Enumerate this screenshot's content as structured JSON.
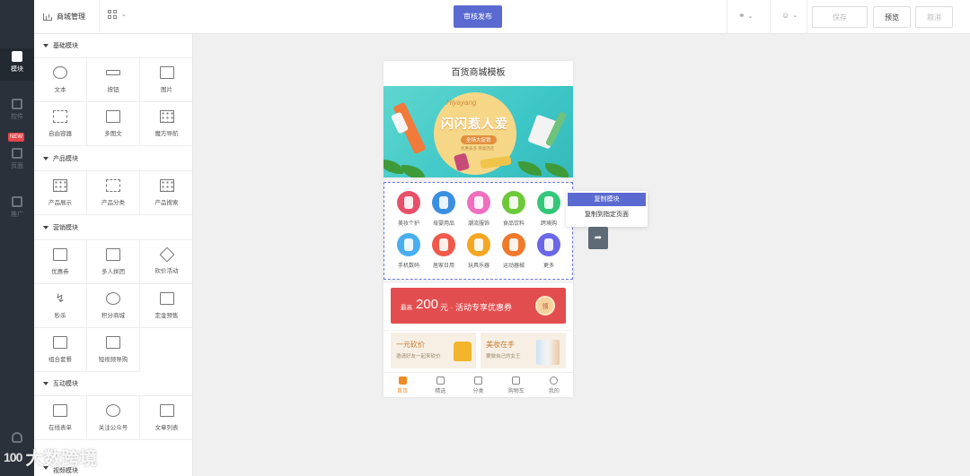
{
  "rail": {
    "items": [
      {
        "label": "模块",
        "icon": "module-icon",
        "active": true
      },
      {
        "label": "控件",
        "icon": "widget-icon",
        "active": false
      },
      {
        "label": "页面",
        "icon": "page-icon",
        "active": false
      },
      {
        "label": "推广",
        "icon": "promote-icon",
        "active": false
      }
    ],
    "new_badge": "NEW"
  },
  "topbar": {
    "store_title": "商城管理",
    "publish_label": "审核发布",
    "save_label": "保存",
    "preview_label": "预览",
    "cancel_label": "取消"
  },
  "sidebar": {
    "categories": [
      {
        "name": "基础模块",
        "items": [
          {
            "label": "文本",
            "icon": "text-icon"
          },
          {
            "label": "按钮",
            "icon": "button-icon"
          },
          {
            "label": "图片",
            "icon": "image-icon"
          },
          {
            "label": "自由容器",
            "icon": "container-icon"
          },
          {
            "label": "多图文",
            "icon": "multi-image-icon"
          },
          {
            "label": "魔方导航",
            "icon": "cube-nav-icon"
          }
        ]
      },
      {
        "name": "产品模块",
        "items": [
          {
            "label": "产品展示",
            "icon": "product-display-icon"
          },
          {
            "label": "产品分类",
            "icon": "product-category-icon"
          },
          {
            "label": "产品搜索",
            "icon": "product-search-icon"
          }
        ]
      },
      {
        "name": "营销模块",
        "items": [
          {
            "label": "优惠券",
            "icon": "coupon-icon"
          },
          {
            "label": "多人拼团",
            "icon": "group-buy-icon"
          },
          {
            "label": "砍价活动",
            "icon": "bargain-icon"
          },
          {
            "label": "秒杀",
            "icon": "flash-sale-icon"
          },
          {
            "label": "积分商城",
            "icon": "points-mall-icon"
          },
          {
            "label": "定金预售",
            "icon": "presale-icon"
          },
          {
            "label": "组合套餐",
            "icon": "bundle-icon"
          },
          {
            "label": "短视频导购",
            "icon": "short-video-icon"
          }
        ]
      },
      {
        "name": "互动模块",
        "items": [
          {
            "label": "在线表单",
            "icon": "form-icon"
          },
          {
            "label": "关注公众号",
            "icon": "follow-icon"
          },
          {
            "label": "文章列表",
            "icon": "article-list-icon"
          }
        ]
      },
      {
        "name": "视频模块",
        "items": []
      }
    ]
  },
  "phone": {
    "title": "百货商城模板",
    "banner": {
      "script": "Hiyayang",
      "title": "闪闪惹人爱",
      "pill": "全场大促销",
      "fine": "优惠多多 惊喜连连"
    },
    "categories": [
      {
        "label": "美妆个护",
        "color": "#e8506a"
      },
      {
        "label": "母婴用品",
        "color": "#3d8fe0"
      },
      {
        "label": "潮流服饰",
        "color": "#f06fbf"
      },
      {
        "label": "食品饮料",
        "color": "#6ec93a"
      },
      {
        "label": "跨境购",
        "color": "#34c779"
      },
      {
        "label": "手机数码",
        "color": "#48aef0"
      },
      {
        "label": "居家日用",
        "color": "#f05a4b"
      },
      {
        "label": "玩具乐器",
        "color": "#f5a623"
      },
      {
        "label": "运动器械",
        "color": "#f07a2c"
      },
      {
        "label": "更多",
        "color": "#6a68e6"
      }
    ],
    "coupon": {
      "prefix": "最高",
      "amount": "200",
      "text": "元 · 活动专享优惠券",
      "get": "领"
    },
    "promos": [
      {
        "title": "一元砍价",
        "sub": "邀请好友一起来砍价"
      },
      {
        "title": "美妆在手",
        "sub": "要做自己的女王"
      }
    ],
    "tabs": [
      {
        "label": "首页",
        "active": true
      },
      {
        "label": "精选",
        "active": false
      },
      {
        "label": "分类",
        "active": false
      },
      {
        "label": "购物车",
        "active": false
      },
      {
        "label": "我的",
        "active": false
      }
    ]
  },
  "context_menu": {
    "copy": "复制模块",
    "copy_to": "复制到指定页面"
  },
  "watermark": {
    "logo": "100",
    "text": "大数跨境"
  }
}
